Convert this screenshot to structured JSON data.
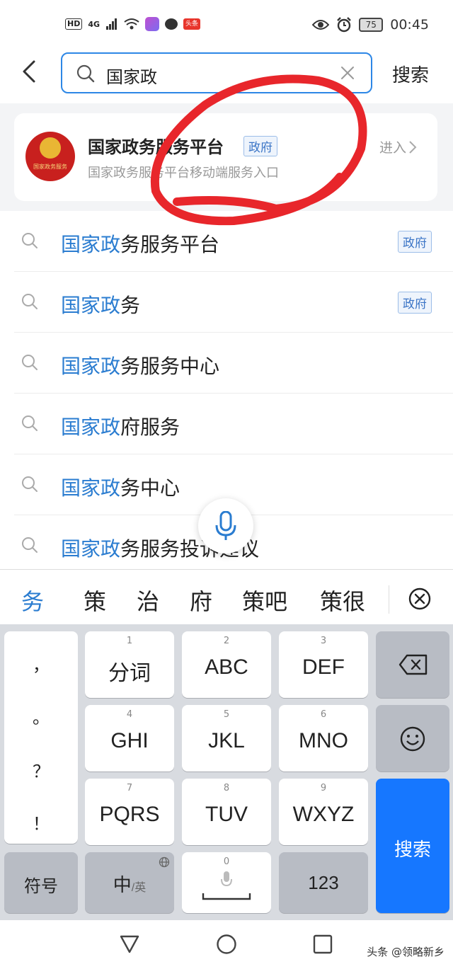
{
  "status_bar": {
    "hd": "HD",
    "network": "4G",
    "app_badge": "头条",
    "battery": "75",
    "time": "00:45"
  },
  "search": {
    "query": "国家政",
    "button_label": "搜索"
  },
  "top_result": {
    "title": "国家政务服务平台",
    "tag": "政府",
    "subtitle": "国家政务服务平台移动端服务入口",
    "enter_label": "进入",
    "emblem_text": "国家政务服务"
  },
  "suggestions": [
    {
      "highlight": "国家政",
      "rest": "务服务平台",
      "tag": "政府"
    },
    {
      "highlight": "国家政",
      "rest": "务",
      "tag": "政府"
    },
    {
      "highlight": "国家政",
      "rest": "务服务中心",
      "tag": ""
    },
    {
      "highlight": "国家政",
      "rest": "府服务",
      "tag": ""
    },
    {
      "highlight": "国家政",
      "rest": "务中心",
      "tag": ""
    },
    {
      "highlight": "国家政",
      "rest": "务服务投诉建议",
      "tag": ""
    }
  ],
  "candidates": [
    "务",
    "策",
    "治",
    "府",
    "策吧",
    "策很"
  ],
  "keyboard": {
    "punct": [
      "，",
      "。",
      "？",
      "！"
    ],
    "keys": [
      {
        "num": "1",
        "label": "分词"
      },
      {
        "num": "2",
        "label": "ABC"
      },
      {
        "num": "3",
        "label": "DEF"
      },
      {
        "num": "4",
        "label": "GHI"
      },
      {
        "num": "5",
        "label": "JKL"
      },
      {
        "num": "6",
        "label": "MNO"
      },
      {
        "num": "7",
        "label": "PQRS"
      },
      {
        "num": "8",
        "label": "TUV"
      },
      {
        "num": "9",
        "label": "WXYZ"
      }
    ],
    "symbol_key": "符号",
    "lang_key_main": "中",
    "lang_key_sub": "/英",
    "space_num": "0",
    "num_key": "123",
    "search_key": "搜索"
  },
  "watermark": "头条 @领略新乡",
  "colors": {
    "accent": "#2d87e6",
    "highlight": "#2a7cd0",
    "annotation": "#e8262b",
    "search_key": "#1677ff"
  }
}
